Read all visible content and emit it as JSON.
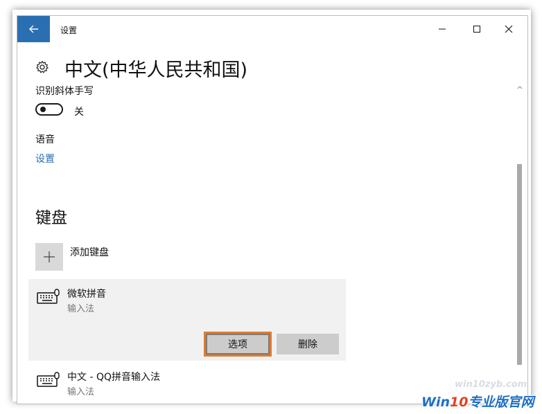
{
  "window": {
    "title": "设置"
  },
  "page": {
    "title": "中文(中华人民共和国)"
  },
  "handwriting": {
    "label": "识别斜体手写",
    "toggle_state": "关"
  },
  "speech": {
    "label": "语音",
    "settings_link": "设置"
  },
  "keyboards": {
    "section_title": "键盘",
    "add_label": "添加键盘",
    "items": [
      {
        "name": "微软拼音",
        "type": "输入法",
        "selected": true
      },
      {
        "name": "中文 - QQ拼音输入法",
        "type": "输入法",
        "selected": false
      }
    ],
    "options_label": "选项",
    "delete_label": "删除"
  },
  "watermark": {
    "url": "win10zyb.com",
    "logo_prefix": "Win",
    "logo_number": "10",
    "logo_suffix": "专业版官网"
  },
  "colors": {
    "accent": "#2b6fb3",
    "highlight_outline": "#e37a2a"
  }
}
